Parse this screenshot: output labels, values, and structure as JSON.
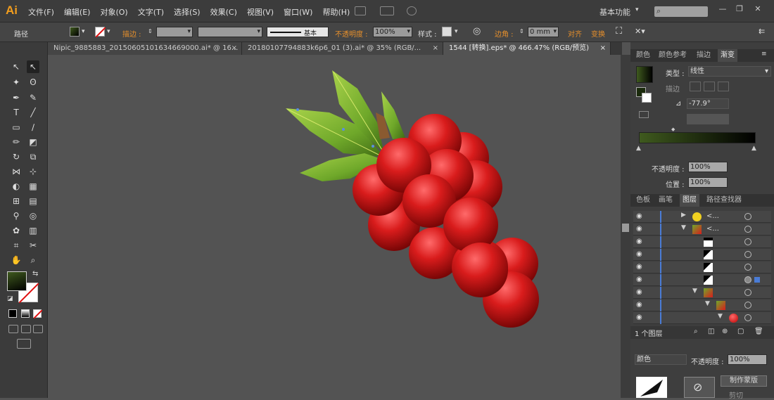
{
  "app": {
    "logo": "Ai"
  },
  "menu": [
    "文件(F)",
    "编辑(E)",
    "对象(O)",
    "文字(T)",
    "选择(S)",
    "效果(C)",
    "视图(V)",
    "窗口(W)",
    "帮助(H)"
  ],
  "workspace": {
    "label": "基本功能"
  },
  "control": {
    "mode": "路径",
    "stroke_label": "描边 :",
    "stroke_profile": "基本",
    "opacity_label": "不透明度 :",
    "opacity_value": "100%",
    "style_label": "样式 :",
    "corner_label": "边角 :",
    "corner_value": "0 mm",
    "align_label": "对齐",
    "transform_label": "变换"
  },
  "doc_tabs": [
    {
      "label": "Nipic_9885883_20150605101634669000.ai* @ 16...",
      "active": false
    },
    {
      "label": "20180107794883k6p6_01 (3).ai* @ 35% (RGB/...",
      "active": false
    },
    {
      "label": "1544 [转换].eps* @ 466.47% (RGB/预览)",
      "active": true
    }
  ],
  "panel_top": {
    "tabs": [
      "颜色",
      "颜色参考",
      "描边",
      "渐变"
    ],
    "active_tab": "渐变",
    "type_label": "类型 :",
    "type_value": "线性",
    "stroke_label": "描边",
    "angle_value": "-77.9°",
    "opacity_label": "不透明度 :",
    "opacity_value": "100%",
    "position_label": "位置 :",
    "position_value": "100%",
    "gradient_start": "#3f5a1e",
    "gradient_end": "#000000"
  },
  "panel_layers": {
    "tabs": [
      "色板",
      "画笔",
      "图层",
      "路径查找器"
    ],
    "active_tab": "图层",
    "rows": [
      {
        "name": "<...",
        "thumb": "yellow-circle"
      },
      {
        "name": "<...",
        "thumb": "red-leaf"
      },
      {
        "name": "",
        "thumb": "white-bar"
      },
      {
        "name": "",
        "thumb": "leaf-shape"
      },
      {
        "name": "",
        "thumb": "leaf-shape"
      },
      {
        "name": "",
        "thumb": "leaf-shape"
      },
      {
        "name": "",
        "thumb": "red-leaf"
      },
      {
        "name": "",
        "thumb": "red-leaf"
      },
      {
        "name": "",
        "thumb": "red-berry"
      }
    ],
    "count_label": "1 个图层"
  },
  "panel_bottom": {
    "blend_mode": "颜色",
    "opacity_label": "不透明度 :",
    "opacity_value": "100%",
    "mask_button": "制作蒙版",
    "clip_label": "剪切"
  },
  "canvas": {
    "berry_color": "#cc1e1e",
    "leaf_color": "#7bb030"
  }
}
